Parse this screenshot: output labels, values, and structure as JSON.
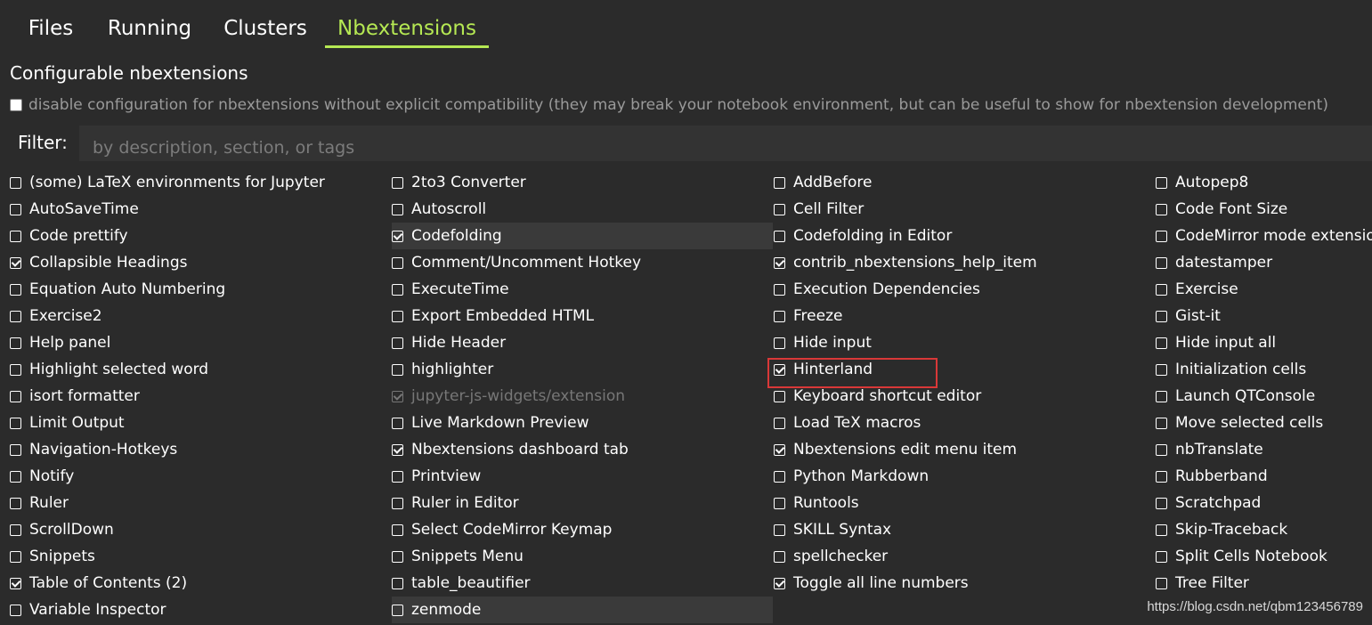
{
  "tabs": [
    "Files",
    "Running",
    "Clusters",
    "Nbextensions"
  ],
  "active_tab": "Nbextensions",
  "section_title": "Configurable nbextensions",
  "compat_option": {
    "label": "disable configuration for nbextensions without explicit compatibility (they may break your notebook environment, but can be useful to show for nbextension development)",
    "checked": false
  },
  "filter": {
    "label": "Filter:",
    "placeholder": "by description, section, or tags",
    "value": ""
  },
  "columns": [
    [
      {
        "label": "(some) LaTeX environments for Jupyter",
        "checked": false
      },
      {
        "label": "AutoSaveTime",
        "checked": false
      },
      {
        "label": "Code prettify",
        "checked": false
      },
      {
        "label": "Collapsible Headings",
        "checked": true
      },
      {
        "label": "Equation Auto Numbering",
        "checked": false
      },
      {
        "label": "Exercise2",
        "checked": false
      },
      {
        "label": "Help panel",
        "checked": false
      },
      {
        "label": "Highlight selected word",
        "checked": false
      },
      {
        "label": "isort formatter",
        "checked": false
      },
      {
        "label": "Limit Output",
        "checked": false
      },
      {
        "label": "Navigation-Hotkeys",
        "checked": false
      },
      {
        "label": "Notify",
        "checked": false
      },
      {
        "label": "Ruler",
        "checked": false
      },
      {
        "label": "ScrollDown",
        "checked": false
      },
      {
        "label": "Snippets",
        "checked": false
      },
      {
        "label": "Table of Contents (2)",
        "checked": true
      },
      {
        "label": "Variable Inspector",
        "checked": false
      }
    ],
    [
      {
        "label": "2to3 Converter",
        "checked": false
      },
      {
        "label": "Autoscroll",
        "checked": false
      },
      {
        "label": "Codefolding",
        "checked": true,
        "highlighted": true
      },
      {
        "label": "Comment/Uncomment Hotkey",
        "checked": false
      },
      {
        "label": "ExecuteTime",
        "checked": false
      },
      {
        "label": "Export Embedded HTML",
        "checked": false
      },
      {
        "label": "Hide Header",
        "checked": false
      },
      {
        "label": "highlighter",
        "checked": false
      },
      {
        "label": "jupyter-js-widgets/extension",
        "checked": true,
        "disabled": true
      },
      {
        "label": "Live Markdown Preview",
        "checked": false
      },
      {
        "label": "Nbextensions dashboard tab",
        "checked": true
      },
      {
        "label": "Printview",
        "checked": false
      },
      {
        "label": "Ruler in Editor",
        "checked": false
      },
      {
        "label": "Select CodeMirror Keymap",
        "checked": false
      },
      {
        "label": "Snippets Menu",
        "checked": false
      },
      {
        "label": "table_beautifier",
        "checked": false
      },
      {
        "label": "zenmode",
        "checked": false,
        "highlighted": true
      }
    ],
    [
      {
        "label": "AddBefore",
        "checked": false
      },
      {
        "label": "Cell Filter",
        "checked": false
      },
      {
        "label": "Codefolding in Editor",
        "checked": false
      },
      {
        "label": "contrib_nbextensions_help_item",
        "checked": true
      },
      {
        "label": "Execution Dependencies",
        "checked": false
      },
      {
        "label": "Freeze",
        "checked": false
      },
      {
        "label": "Hide input",
        "checked": false
      },
      {
        "label": "Hinterland",
        "checked": true
      },
      {
        "label": "Keyboard shortcut editor",
        "checked": false
      },
      {
        "label": "Load TeX macros",
        "checked": false
      },
      {
        "label": "Nbextensions edit menu item",
        "checked": true
      },
      {
        "label": "Python Markdown",
        "checked": false
      },
      {
        "label": "Runtools",
        "checked": false
      },
      {
        "label": "SKILL Syntax",
        "checked": false
      },
      {
        "label": "spellchecker",
        "checked": false
      },
      {
        "label": "Toggle all line numbers",
        "checked": true
      }
    ],
    [
      {
        "label": "Autopep8",
        "checked": false
      },
      {
        "label": "Code Font Size",
        "checked": false
      },
      {
        "label": "CodeMirror mode extensions",
        "checked": false
      },
      {
        "label": "datestamper",
        "checked": false
      },
      {
        "label": "Exercise",
        "checked": false
      },
      {
        "label": "Gist-it",
        "checked": false
      },
      {
        "label": "Hide input all",
        "checked": false
      },
      {
        "label": "Initialization cells",
        "checked": false
      },
      {
        "label": "Launch QTConsole",
        "checked": false
      },
      {
        "label": "Move selected cells",
        "checked": false
      },
      {
        "label": "nbTranslate",
        "checked": false
      },
      {
        "label": "Rubberband",
        "checked": false
      },
      {
        "label": "Scratchpad",
        "checked": false
      },
      {
        "label": "Skip-Traceback",
        "checked": false
      },
      {
        "label": "Split Cells Notebook",
        "checked": false
      },
      {
        "label": "Tree Filter",
        "checked": false
      }
    ]
  ],
  "watermark": "https://blog.csdn.net/qbm123456789",
  "colors": {
    "background": "#2b2b2b",
    "accent": "#b5e853",
    "callout": "#d93838",
    "muted_text": "#9a9a9a"
  }
}
